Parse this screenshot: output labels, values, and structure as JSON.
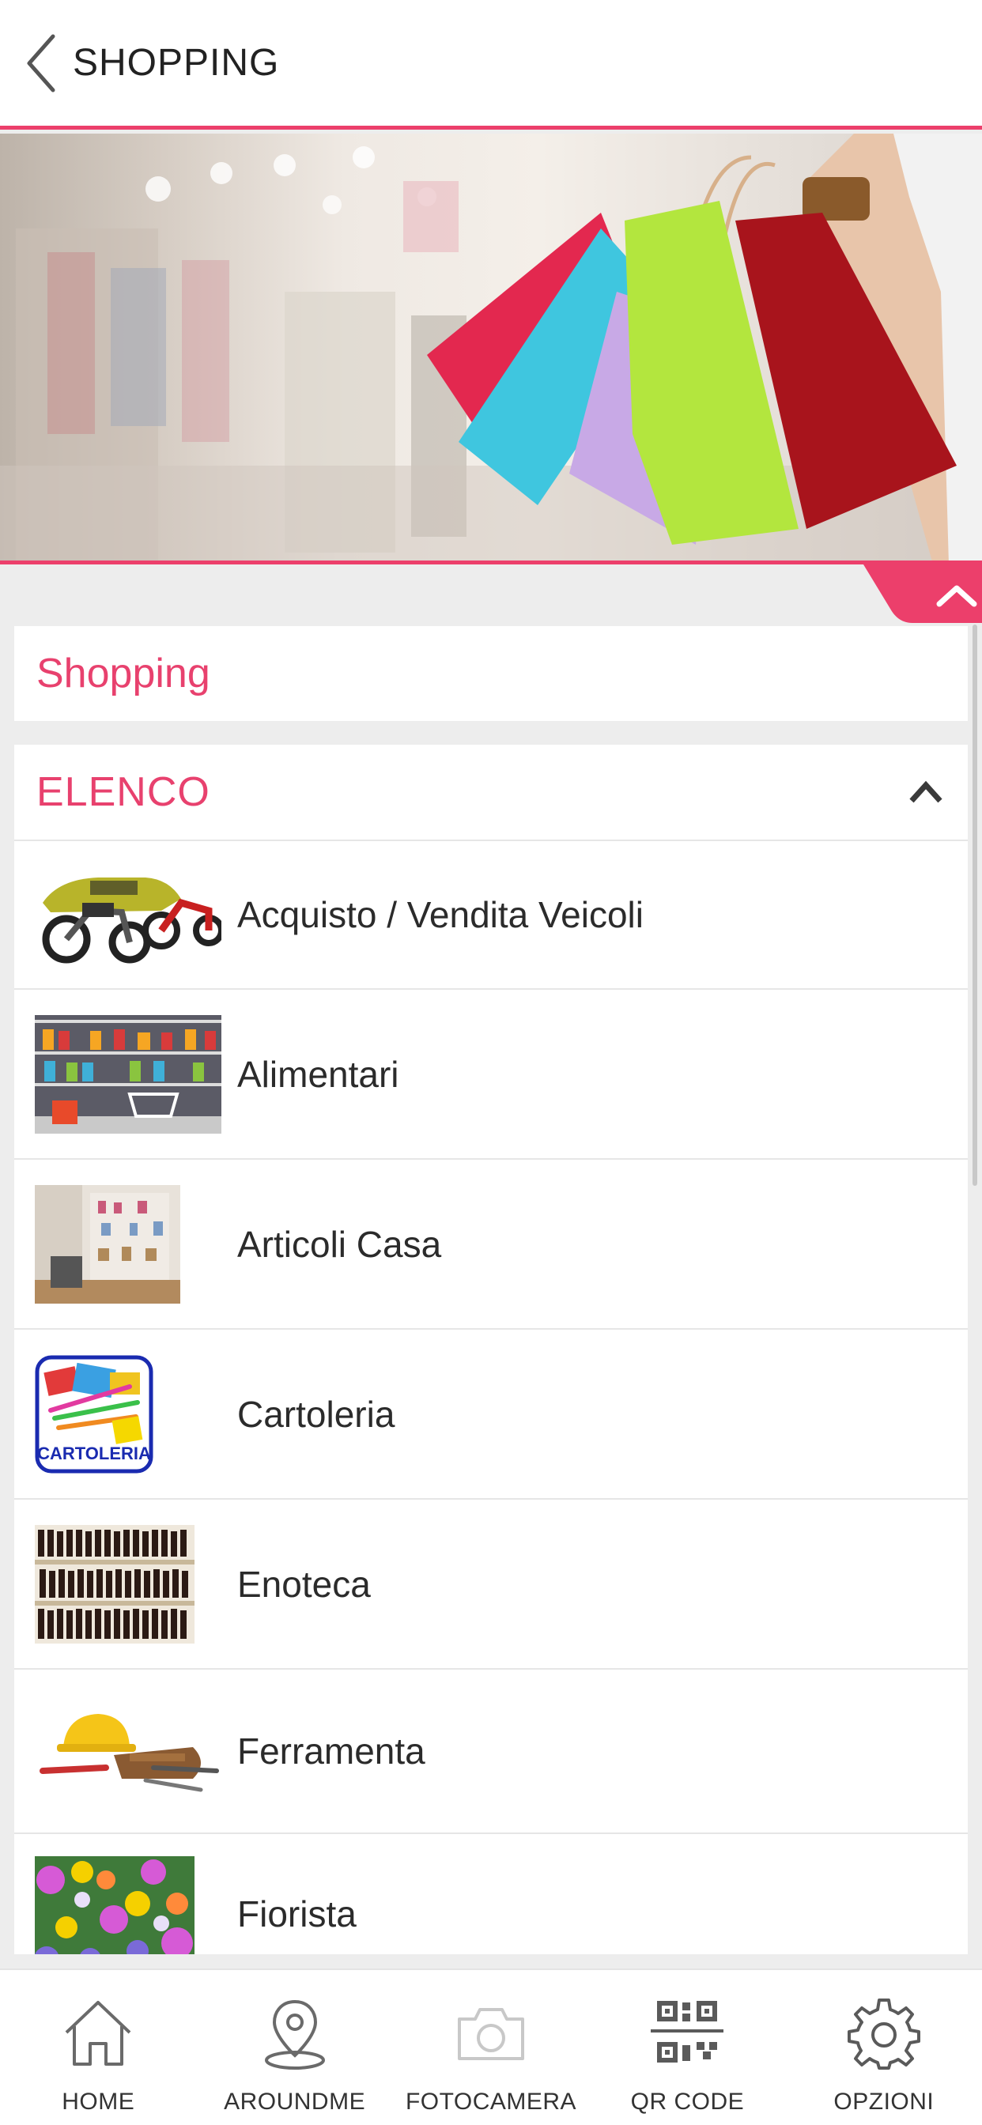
{
  "header": {
    "title": "SHOPPING",
    "back_icon": "chevron-left-icon"
  },
  "page": {
    "section_title": "Shopping"
  },
  "list": {
    "header_label": "ELENCO",
    "toggle_icon": "chevron-up-icon",
    "items": [
      {
        "label": "Acquisto / Vendita Veicoli",
        "thumb": "vehicles-thumbnail"
      },
      {
        "label": "Alimentari",
        "thumb": "grocery-thumbnail"
      },
      {
        "label": "Articoli Casa",
        "thumb": "home-goods-thumbnail"
      },
      {
        "label": "Cartoleria",
        "thumb": "stationery-thumbnail",
        "thumb_text": "CARTOLERIA"
      },
      {
        "label": "Enoteca",
        "thumb": "wine-shop-thumbnail"
      },
      {
        "label": "Ferramenta",
        "thumb": "hardware-thumbnail"
      },
      {
        "label": "Fiorista",
        "thumb": "florist-thumbnail"
      }
    ]
  },
  "bottom_nav": {
    "items": [
      {
        "label": "HOME",
        "icon": "home-icon"
      },
      {
        "label": "AROUNDME",
        "icon": "location-pin-icon"
      },
      {
        "label": "FOTOCAMERA",
        "icon": "camera-icon"
      },
      {
        "label": "QR CODE",
        "icon": "qr-code-icon"
      },
      {
        "label": "OPZIONI",
        "icon": "gear-icon"
      }
    ]
  },
  "colors": {
    "accent": "#e8416e",
    "header_border": "#ec3f6b",
    "background": "#ededed"
  }
}
